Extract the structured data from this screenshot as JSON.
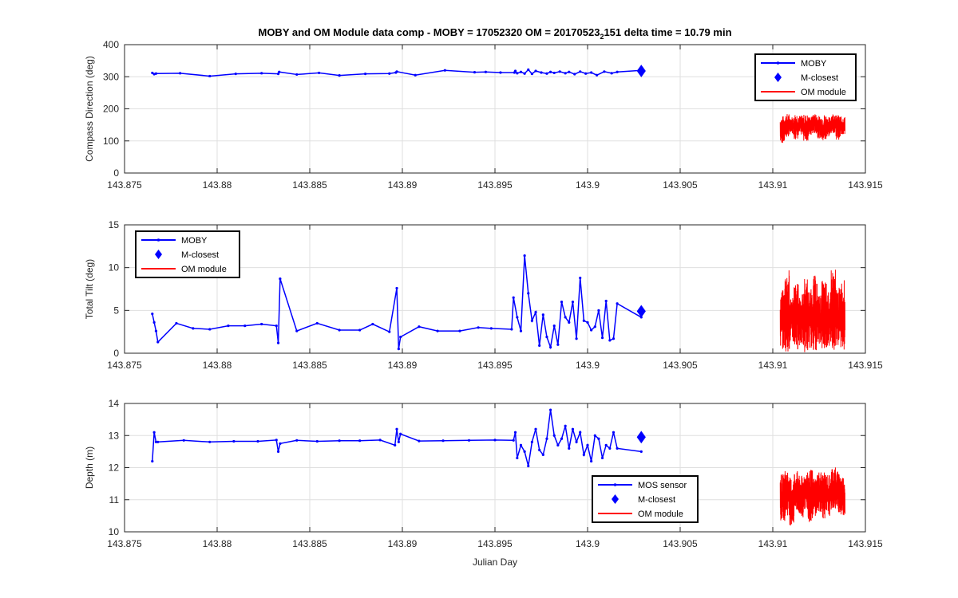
{
  "figure": {
    "title_main": "MOBY and OM Module data comp - MOBY = 17052320 OM = 20170523",
    "title_sub": "2",
    "title_tail": "151 delta time = 10.79 min",
    "xlabel": "Julian Day"
  },
  "colors": {
    "moby": "#0000ff",
    "om": "#ff0000",
    "grid": "#dfdfdf",
    "axis": "#262626"
  },
  "chart_data": [
    {
      "type": "line",
      "ylabel": "Compass Direction (deg)",
      "xlim": [
        143.875,
        143.915
      ],
      "ylim": [
        0,
        400
      ],
      "xticks": [
        "143.875",
        "143.88",
        "143.885",
        "143.89",
        "143.895",
        "143.9",
        "143.905",
        "143.91",
        "143.915"
      ],
      "yticks": [
        "0",
        "100",
        "200",
        "300",
        "400"
      ],
      "grid": true,
      "legend_position": "top-right",
      "legend": [
        "MOBY",
        "M-closest",
        "OM module"
      ],
      "series": [
        {
          "name": "MOBY",
          "x": [
            143.8765,
            143.8766,
            143.8767,
            143.878,
            143.8796,
            143.881,
            143.8824,
            143.8833,
            143.88335,
            143.8843,
            143.8855,
            143.8866,
            143.888,
            143.8893,
            143.88965,
            143.8897,
            143.8907,
            143.8923,
            143.8939,
            143.8945,
            143.8953,
            143.89605,
            143.8961,
            143.8962,
            143.8964,
            143.8966,
            143.8968,
            143.897,
            143.8972,
            143.8975,
            143.8978,
            143.898,
            143.8982,
            143.8985,
            143.8988,
            143.899,
            143.8993,
            143.8996,
            143.8999,
            143.9002,
            143.9005,
            143.9009,
            143.9013,
            143.9016,
            143.9029
          ],
          "y": [
            312,
            308,
            310,
            311,
            302,
            309,
            311,
            309,
            315,
            307,
            312,
            304,
            309,
            310,
            313,
            316,
            305,
            320,
            314,
            315,
            313,
            313,
            318,
            311,
            315,
            310,
            322,
            309,
            318,
            313,
            310,
            315,
            312,
            316,
            311,
            315,
            308,
            316,
            310,
            313,
            305,
            316,
            311,
            315,
            320
          ]
        },
        {
          "name": "M-closest",
          "x": [
            143.9029
          ],
          "y": [
            318
          ]
        },
        {
          "name": "OM module",
          "x_range": [
            143.9104,
            143.9139
          ],
          "y_min": [
            92,
            110,
            120,
            105,
            118,
            100,
            115,
            122,
            108,
            97,
            112,
            125,
            104,
            118
          ],
          "y_max": [
            178,
            185,
            176,
            188,
            180,
            183,
            177,
            186,
            179,
            184,
            175,
            187,
            181,
            176
          ]
        }
      ]
    },
    {
      "type": "line",
      "ylabel": "Total Tilt (deg)",
      "xlim": [
        143.875,
        143.915
      ],
      "ylim": [
        0,
        15
      ],
      "xticks": [
        "143.875",
        "143.88",
        "143.885",
        "143.89",
        "143.895",
        "143.9",
        "143.905",
        "143.91",
        "143.915"
      ],
      "yticks": [
        "0",
        "5",
        "10",
        "15"
      ],
      "grid": true,
      "legend_position": "top-left",
      "legend": [
        "MOBY",
        "M-closest",
        "OM module"
      ],
      "series": [
        {
          "name": "MOBY",
          "x": [
            143.8765,
            143.8766,
            143.8767,
            143.8768,
            143.8778,
            143.8787,
            143.8796,
            143.8806,
            143.8815,
            143.8824,
            143.8832,
            143.8833,
            143.8834,
            143.8843,
            143.8854,
            143.8866,
            143.8877,
            143.8884,
            143.8893,
            143.8897,
            143.8898,
            143.8899,
            143.8909,
            143.8919,
            143.8931,
            143.8941,
            143.8948,
            143.8959,
            143.896,
            143.8962,
            143.8964,
            143.8966,
            143.8968,
            143.897,
            143.8972,
            143.8974,
            143.8976,
            143.8978,
            143.898,
            143.8982,
            143.8984,
            143.8986,
            143.8988,
            143.899,
            143.8992,
            143.8994,
            143.8996,
            143.8998,
            143.9,
            143.9002,
            143.9004,
            143.9006,
            143.9008,
            143.901,
            143.9012,
            143.9014,
            143.9016,
            143.9029
          ],
          "y": [
            4.6,
            3.6,
            2.6,
            1.3,
            3.5,
            2.9,
            2.8,
            3.2,
            3.2,
            3.4,
            3.2,
            1.2,
            8.7,
            2.6,
            3.5,
            2.7,
            2.7,
            3.4,
            2.5,
            7.6,
            0.5,
            1.9,
            3.1,
            2.6,
            2.6,
            3.0,
            2.9,
            2.8,
            6.5,
            4.2,
            2.6,
            11.4,
            7.0,
            3.8,
            4.8,
            0.9,
            4.5,
            1.9,
            0.7,
            3.2,
            1.0,
            6.0,
            4.2,
            3.6,
            6.0,
            1.7,
            8.8,
            3.8,
            3.6,
            2.7,
            3.1,
            5.0,
            1.8,
            6.1,
            1.5,
            1.7,
            5.8,
            4.2
          ]
        },
        {
          "name": "M-closest",
          "x": [
            143.9029
          ],
          "y": [
            4.9
          ]
        },
        {
          "name": "OM module",
          "x_range": [
            143.9104,
            143.9139
          ],
          "y_min": [
            0.5,
            0.2,
            1.0,
            0.4,
            0.8,
            0.1,
            0.6,
            0.3,
            1.1,
            0.2,
            0.7,
            0.4,
            0.9,
            0.3
          ],
          "y_max": [
            7.4,
            9.8,
            6.8,
            8.2,
            7.1,
            8.8,
            7.5,
            9.1,
            6.9,
            8.5,
            7.2,
            9.9,
            7.7,
            8.6
          ]
        }
      ]
    },
    {
      "type": "line",
      "ylabel": "Depth (m)",
      "xlabel": "Julian Day",
      "xlim": [
        143.875,
        143.915
      ],
      "ylim": [
        10,
        14
      ],
      "xticks": [
        "143.875",
        "143.88",
        "143.885",
        "143.89",
        "143.895",
        "143.9",
        "143.905",
        "143.91",
        "143.915"
      ],
      "yticks": [
        "10",
        "11",
        "12",
        "13",
        "14"
      ],
      "grid": true,
      "legend_position": "bottom-center",
      "legend": [
        "MOS sensor",
        "M-closest",
        "OM module"
      ],
      "series": [
        {
          "name": "MOS sensor",
          "x": [
            143.8765,
            143.8766,
            143.8767,
            143.8768,
            143.8782,
            143.8796,
            143.8809,
            143.8822,
            143.8832,
            143.8833,
            143.8834,
            143.8843,
            143.8854,
            143.8866,
            143.8877,
            143.8888,
            143.8896,
            143.8897,
            143.8898,
            143.8899,
            143.8909,
            143.8922,
            143.8936,
            143.895,
            143.896,
            143.8961,
            143.8962,
            143.8964,
            143.8966,
            143.8968,
            143.897,
            143.8972,
            143.8974,
            143.8976,
            143.8978,
            143.898,
            143.8982,
            143.8984,
            143.8986,
            143.8988,
            143.899,
            143.8992,
            143.8994,
            143.8996,
            143.8998,
            143.9,
            143.9002,
            143.9004,
            143.9006,
            143.9008,
            143.901,
            143.9012,
            143.9014,
            143.9016,
            143.9029
          ],
          "y": [
            12.2,
            13.1,
            12.8,
            12.8,
            12.85,
            12.8,
            12.82,
            12.82,
            12.86,
            12.5,
            12.75,
            12.85,
            12.82,
            12.84,
            12.84,
            12.86,
            12.7,
            13.2,
            12.8,
            13.05,
            12.83,
            12.84,
            12.85,
            12.86,
            12.85,
            13.1,
            12.3,
            12.7,
            12.5,
            12.05,
            12.8,
            13.2,
            12.55,
            12.4,
            12.9,
            13.8,
            13.0,
            12.7,
            12.9,
            13.3,
            12.6,
            13.2,
            12.8,
            13.1,
            12.4,
            12.7,
            12.2,
            13.0,
            12.9,
            12.3,
            12.7,
            12.6,
            13.1,
            12.6,
            12.5
          ]
        },
        {
          "name": "M-closest",
          "x": [
            143.9029
          ],
          "y": [
            12.95
          ]
        },
        {
          "name": "OM module",
          "x_range": [
            143.9104,
            143.9139
          ],
          "y_min": [
            10.3,
            10.5,
            10.2,
            10.6,
            10.4,
            10.7,
            10.3,
            10.5,
            10.6,
            10.4,
            10.5,
            10.7,
            10.6,
            10.5
          ],
          "y_max": [
            11.8,
            11.95,
            11.7,
            11.9,
            11.75,
            11.85,
            11.95,
            11.7,
            11.9,
            11.85,
            11.8,
            12.05,
            11.9,
            11.75
          ]
        }
      ]
    }
  ]
}
